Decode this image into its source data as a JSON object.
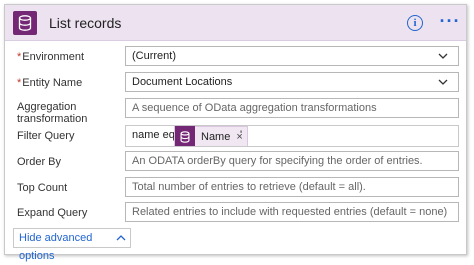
{
  "header": {
    "title": "List records",
    "info_label": "i",
    "more_label": "···",
    "accent_color": "#742774",
    "background_color": "#ece2f0"
  },
  "fields": {
    "environment": {
      "required_mark": "*",
      "label": "Environment",
      "value": "(Current)"
    },
    "entity_name": {
      "required_mark": "*",
      "label": "Entity Name",
      "value": "Document Locations"
    },
    "aggregation": {
      "label_line1": "Aggregation",
      "label_line2": "transformation",
      "placeholder": "A sequence of OData aggregation transformations"
    },
    "filter_query": {
      "label": "Filter Query",
      "prefix": "name eq '",
      "token_label": "Name",
      "token_remove": "×",
      "suffix": "'"
    },
    "order_by": {
      "label": "Order By",
      "placeholder": "An ODATA orderBy query for specifying the order of entries."
    },
    "top_count": {
      "label": "Top Count",
      "placeholder": "Total number of entries to retrieve (default = all)."
    },
    "expand_query": {
      "label": "Expand Query",
      "placeholder": "Related entries to include with requested entries (default = none)"
    }
  },
  "advanced": {
    "label": "Hide advanced options"
  },
  "icons": {
    "header": "database-icon",
    "token": "database-icon",
    "info": "info-icon",
    "more": "more-icon"
  }
}
